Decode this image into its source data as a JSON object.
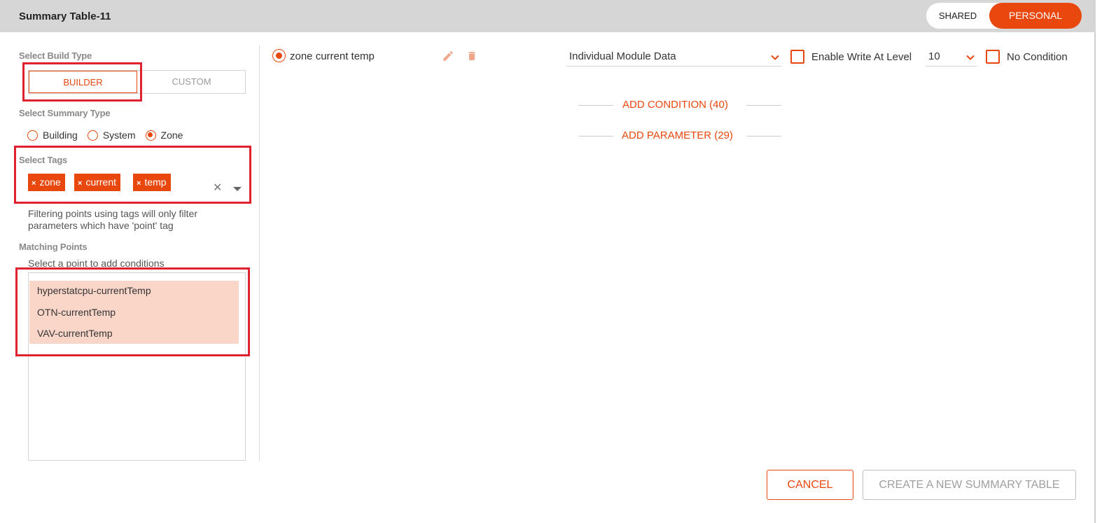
{
  "header": {
    "title": "Summary Table-11",
    "share_options": [
      "SHARED",
      "PERSONAL"
    ],
    "share_selected": "PERSONAL"
  },
  "left": {
    "build_type": {
      "label": "Select Build Type",
      "options": [
        "BUILDER",
        "CUSTOM"
      ],
      "selected": "BUILDER"
    },
    "summary_type": {
      "label": "Select Summary Type",
      "options": [
        "Building",
        "System",
        "Zone"
      ],
      "selected": "Zone"
    },
    "tags": {
      "label": "Select Tags",
      "items": [
        "zone",
        "current",
        "temp"
      ],
      "remove_glyph": "×",
      "clear_glyph": "✕"
    },
    "help_text": "Filtering points using tags will only filter parameters which have 'point' tag",
    "matching_points": {
      "label": "Matching Points",
      "sub_label": "Select a point to add conditions",
      "items": [
        "hyperstatcpu-currentTemp",
        "OTN-currentTemp",
        "VAV-currentTemp"
      ]
    }
  },
  "right": {
    "point_name": "zone current temp",
    "data_select": "Individual Module Data",
    "enable_write_label": "Enable Write At Level",
    "enable_write_checked": false,
    "level_select": "10",
    "no_condition_label": "No Condition",
    "no_condition_checked": false,
    "add_condition": "ADD CONDITION (40)",
    "add_parameter": "ADD PARAMETER (29)"
  },
  "footer": {
    "cancel": "CANCEL",
    "create": "CREATE A NEW SUMMARY TABLE"
  },
  "colors": {
    "accent": "#e8470e",
    "highlight_box": "#e02130",
    "selection_fill": "#fad6c9",
    "header_bg": "#d6d6d6"
  },
  "icons": {
    "edit": "pencil-icon",
    "delete": "trash-icon",
    "dropdown": "chevron-down-icon",
    "tag_remove": "close-icon"
  }
}
